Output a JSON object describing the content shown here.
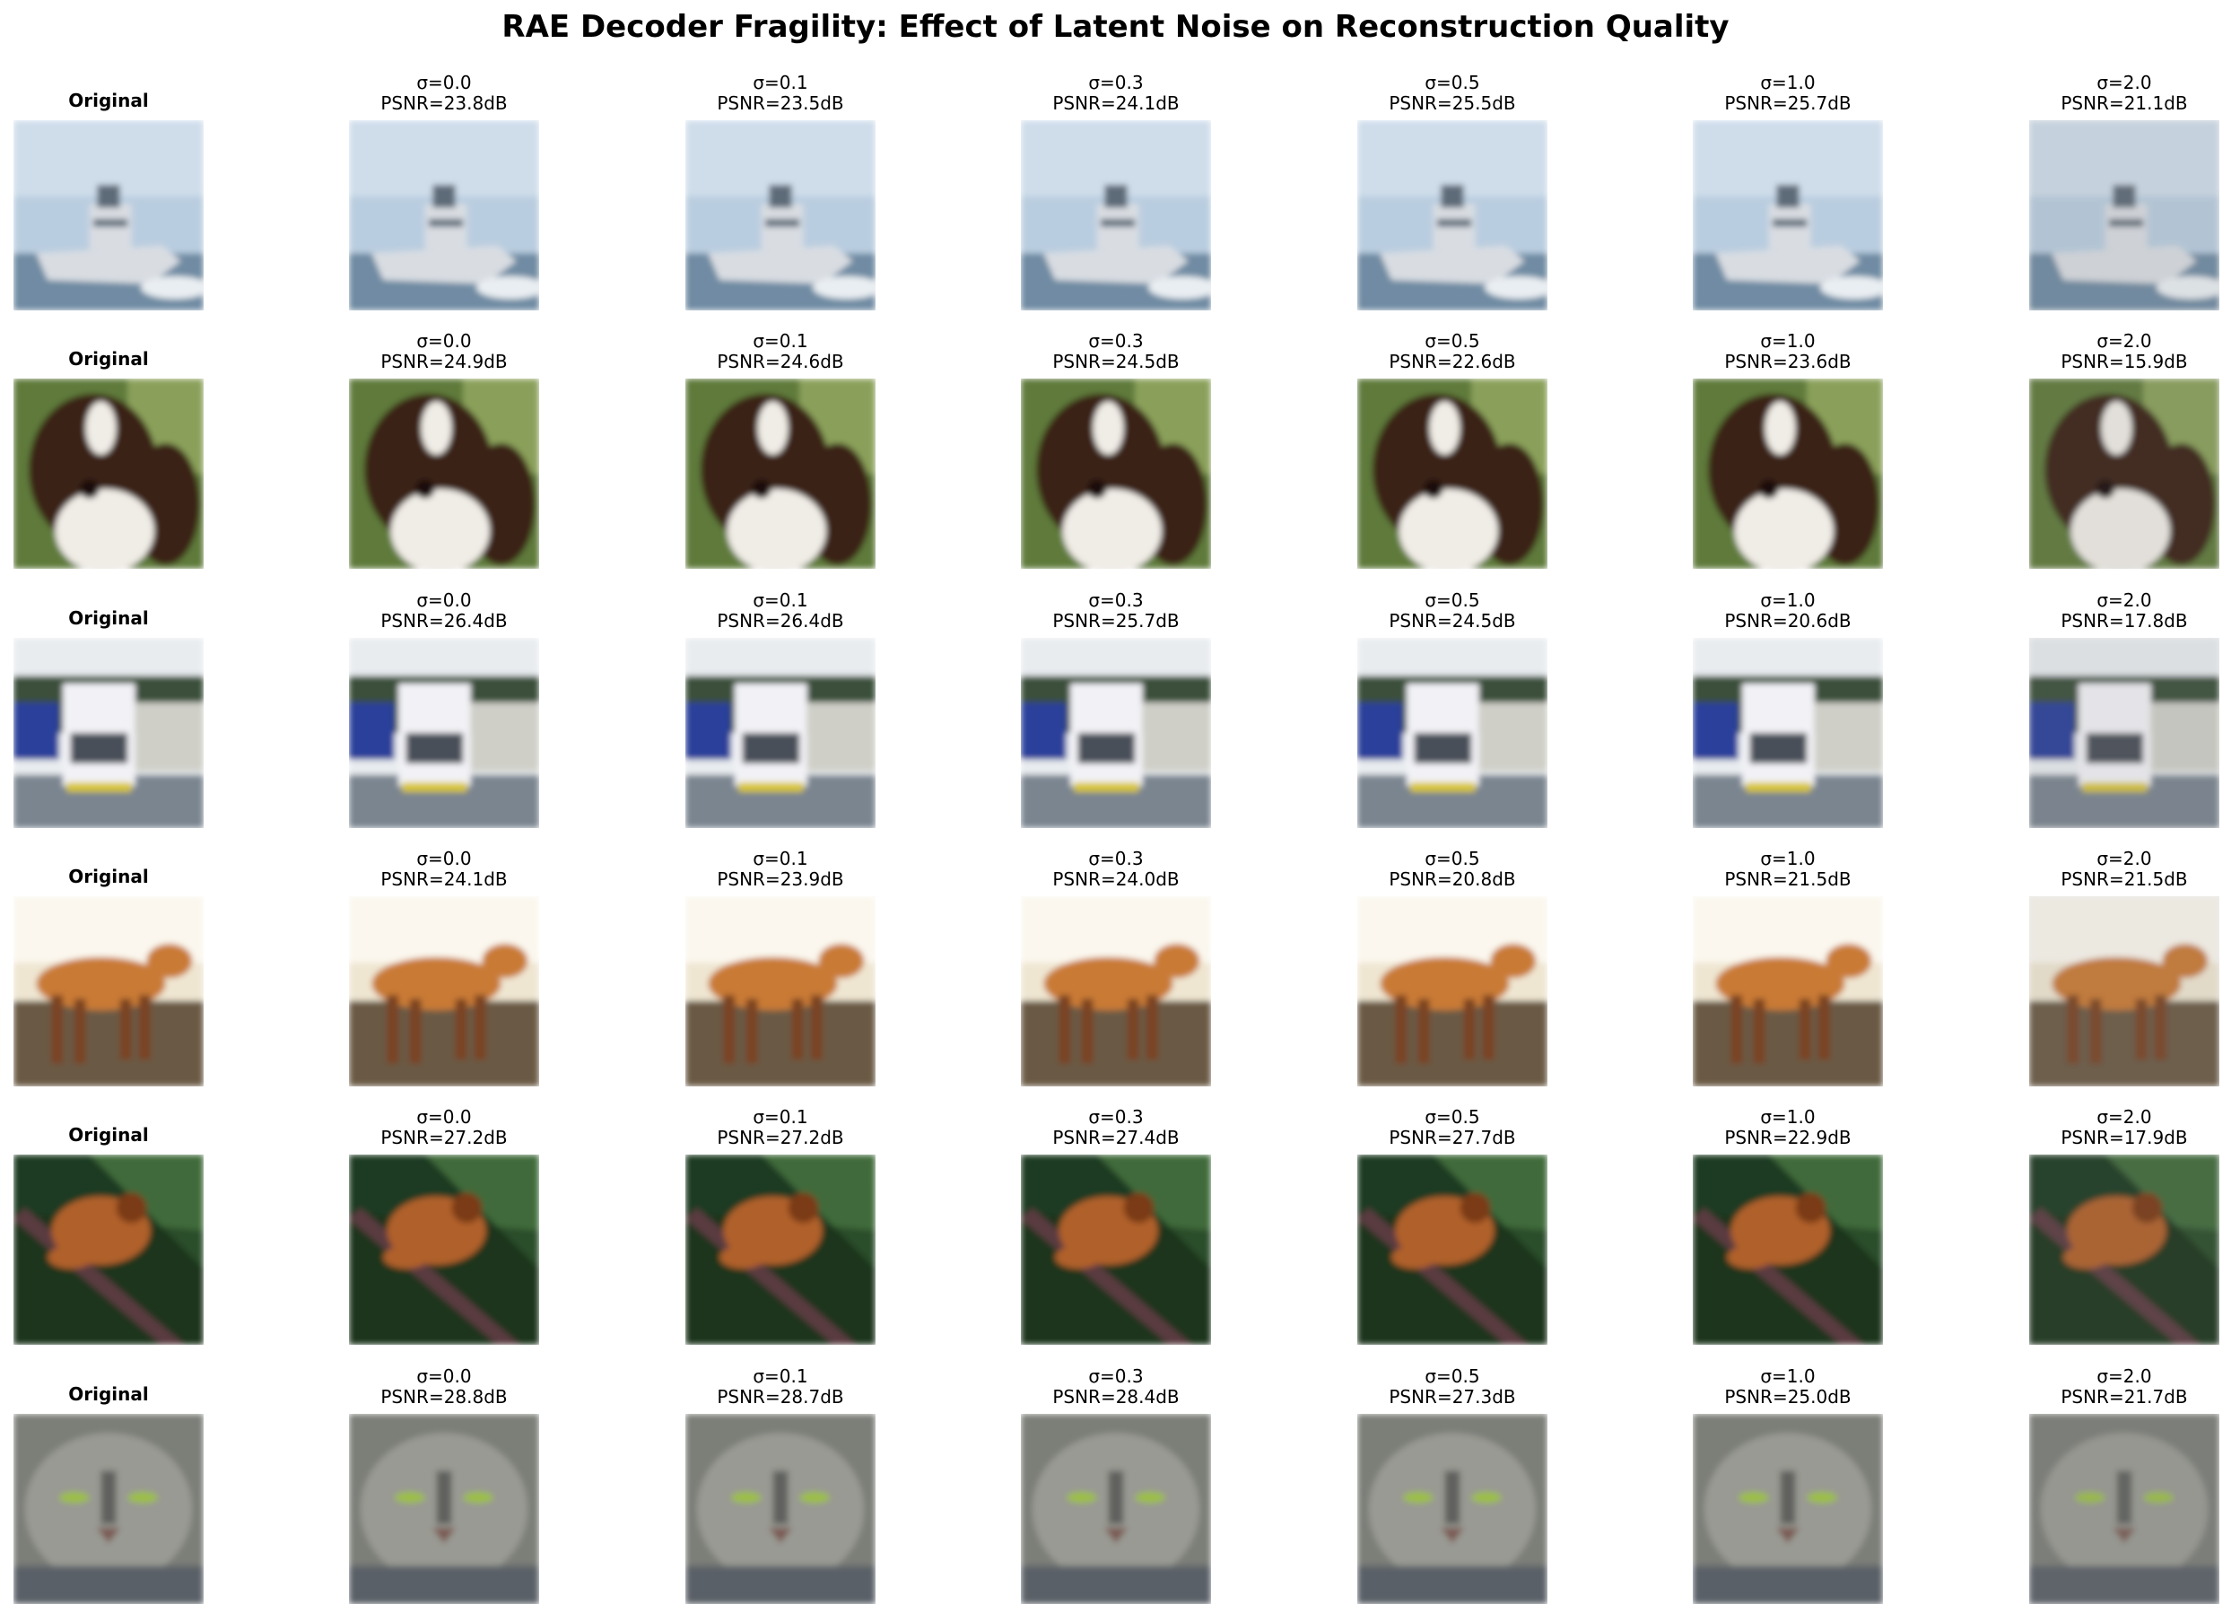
{
  "title": "RAE Decoder Fragility: Effect of Latent Noise on Reconstruction Quality",
  "original_label": "Original",
  "rows": [
    {
      "subject": "boat-icon",
      "colors": {
        "sky": "#b9cde0",
        "sky2": "#dde8f0",
        "ground": "#6f8ba3",
        "main": "#d9dde2",
        "dark": "#5d6b78"
      },
      "cells": [
        {
          "sigma": "σ=0.0",
          "psnr": "PSNR=23.8dB"
        },
        {
          "sigma": "σ=0.1",
          "psnr": "PSNR=23.5dB"
        },
        {
          "sigma": "σ=0.3",
          "psnr": "PSNR=24.1dB"
        },
        {
          "sigma": "σ=0.5",
          "psnr": "PSNR=25.5dB"
        },
        {
          "sigma": "σ=1.0",
          "psnr": "PSNR=25.7dB"
        },
        {
          "sigma": "σ=2.0",
          "psnr": "PSNR=21.1dB"
        }
      ]
    },
    {
      "subject": "dog-icon",
      "colors": {
        "sky": "#5e7a3a",
        "sky2": "#8aa05a",
        "ground": "#4b5e2c",
        "main": "#3a2214",
        "dark": "#f0ece6"
      },
      "cells": [
        {
          "sigma": "σ=0.0",
          "psnr": "PSNR=24.9dB"
        },
        {
          "sigma": "σ=0.1",
          "psnr": "PSNR=24.6dB"
        },
        {
          "sigma": "σ=0.3",
          "psnr": "PSNR=24.5dB"
        },
        {
          "sigma": "σ=0.5",
          "psnr": "PSNR=22.6dB"
        },
        {
          "sigma": "σ=1.0",
          "psnr": "PSNR=23.6dB"
        },
        {
          "sigma": "σ=2.0",
          "psnr": "PSNR=15.9dB"
        }
      ]
    },
    {
      "subject": "truck-icon",
      "colors": {
        "sky": "#e8ecef",
        "sky2": "#3a4f3a",
        "ground": "#7a8590",
        "main": "#f2f2f6",
        "dark": "#2a3f9a"
      },
      "cells": [
        {
          "sigma": "σ=0.0",
          "psnr": "PSNR=26.4dB"
        },
        {
          "sigma": "σ=0.1",
          "psnr": "PSNR=26.4dB"
        },
        {
          "sigma": "σ=0.3",
          "psnr": "PSNR=25.7dB"
        },
        {
          "sigma": "σ=0.5",
          "psnr": "PSNR=24.5dB"
        },
        {
          "sigma": "σ=1.0",
          "psnr": "PSNR=20.6dB"
        },
        {
          "sigma": "σ=2.0",
          "psnr": "PSNR=17.8dB"
        }
      ]
    },
    {
      "subject": "horse-icon",
      "colors": {
        "sky": "#efe6d2",
        "sky2": "#fbf7ee",
        "ground": "#6a5a44",
        "main": "#c97a34",
        "dark": "#7a4220"
      },
      "cells": [
        {
          "sigma": "σ=0.0",
          "psnr": "PSNR=24.1dB"
        },
        {
          "sigma": "σ=0.1",
          "psnr": "PSNR=23.9dB"
        },
        {
          "sigma": "σ=0.3",
          "psnr": "PSNR=24.0dB"
        },
        {
          "sigma": "σ=0.5",
          "psnr": "PSNR=20.8dB"
        },
        {
          "sigma": "σ=1.0",
          "psnr": "PSNR=21.5dB"
        },
        {
          "sigma": "σ=2.0",
          "psnr": "PSNR=21.5dB"
        }
      ]
    },
    {
      "subject": "frog-icon",
      "colors": {
        "sky": "#1e3a22",
        "sky2": "#3f6a3a",
        "ground": "#173019",
        "main": "#b0602a",
        "dark": "#5a3a40"
      },
      "cells": [
        {
          "sigma": "σ=0.0",
          "psnr": "PSNR=27.2dB"
        },
        {
          "sigma": "σ=0.1",
          "psnr": "PSNR=27.2dB"
        },
        {
          "sigma": "σ=0.3",
          "psnr": "PSNR=27.4dB"
        },
        {
          "sigma": "σ=0.5",
          "psnr": "PSNR=27.7dB"
        },
        {
          "sigma": "σ=1.0",
          "psnr": "PSNR=22.9dB"
        },
        {
          "sigma": "σ=2.0",
          "psnr": "PSNR=17.9dB"
        }
      ]
    },
    {
      "subject": "cat-icon",
      "colors": {
        "sky": "#7c7e78",
        "sky2": "#a5a69e",
        "ground": "#5a6068",
        "main": "#9a9b94",
        "dark": "#3c3e3a"
      },
      "cells": [
        {
          "sigma": "σ=0.0",
          "psnr": "PSNR=28.8dB"
        },
        {
          "sigma": "σ=0.1",
          "psnr": "PSNR=28.7dB"
        },
        {
          "sigma": "σ=0.3",
          "psnr": "PSNR=28.4dB"
        },
        {
          "sigma": "σ=0.5",
          "psnr": "PSNR=27.3dB"
        },
        {
          "sigma": "σ=1.0",
          "psnr": "PSNR=25.0dB"
        },
        {
          "sigma": "σ=2.0",
          "psnr": "PSNR=21.7dB"
        }
      ]
    }
  ]
}
